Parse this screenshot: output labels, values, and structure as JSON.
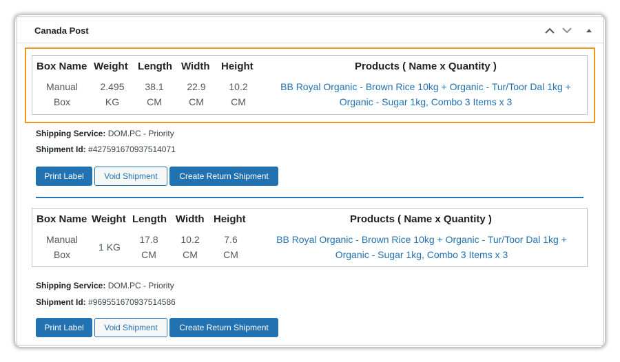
{
  "panel": {
    "title": "Canada Post"
  },
  "table_headers": {
    "box_name": "Box Name",
    "weight": "Weight",
    "length": "Length",
    "width": "Width",
    "height": "Height",
    "products": "Products ( Name x Quantity )"
  },
  "shipments": [
    {
      "box_name_line1": "Manual",
      "box_name_line2": "Box",
      "weight_line1": "2.495",
      "weight_line2": "KG",
      "length_line1": "38.1",
      "length_line2": "CM",
      "width_line1": "22.9",
      "width_line2": "CM",
      "height_line1": "10.2",
      "height_line2": "CM",
      "products_line1": "BB Royal Organic - Brown Rice 10kg + Organic - Tur/Toor Dal 1kg +",
      "products_line2": "Organic - Sugar 1kg, Combo 3 Items x 3",
      "service_label": "Shipping Service:",
      "service_value": "DOM.PC - Priority",
      "id_label": "Shipment Id:",
      "id_value": "#427591670937514071",
      "print_label": "Print Label",
      "void_label": "Void Shipment",
      "return_label": "Create Return Shipment"
    },
    {
      "box_name_line1": "Manual",
      "box_name_line2": "Box",
      "weight_line1": "1 KG",
      "length_line1": "17.8",
      "length_line2": "CM",
      "width_line1": "10.2",
      "width_line2": "CM",
      "height_line1": "7.6",
      "height_line2": "CM",
      "products_line1": "BB Royal Organic - Brown Rice 10kg + Organic - Tur/Toor Dal 1kg +",
      "products_line2": "Organic - Sugar 1kg, Combo 3 Items x 3",
      "service_label": "Shipping Service:",
      "service_value": "DOM.PC - Priority",
      "id_label": "Shipment Id:",
      "id_value": "#969551670937514586",
      "print_label": "Print Label",
      "void_label": "Void Shipment",
      "return_label": "Create Return Shipment"
    }
  ],
  "colors": {
    "accent": "#2271b1",
    "highlight": "#f0961e"
  },
  "icons": {
    "move_up": "chevron-up-icon",
    "move_down": "chevron-down-icon",
    "toggle": "triangle-up-icon"
  }
}
